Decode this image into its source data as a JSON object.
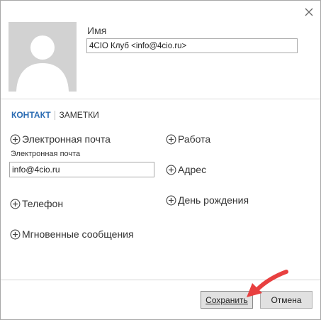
{
  "dialog": {
    "close_icon": "close-icon",
    "name_label": "Имя",
    "name_value": "4CIO Клуб <info@4cio.ru>"
  },
  "tabs": {
    "contact": "КОНТАКТ",
    "notes": "ЗАМЕТКИ"
  },
  "fields": {
    "email_add": "Электронная почта",
    "email_caption": "Электронная почта",
    "email_value": "info@4cio.ru",
    "phone_add": "Телефон",
    "im_add": "Мгновенные сообщения",
    "work_add": "Работа",
    "address_add": "Адрес",
    "birthday_add": "День рождения"
  },
  "buttons": {
    "save": "Сохранить",
    "cancel": "Отмена"
  },
  "colors": {
    "accent_tab": "#2b6cb3",
    "annotation_arrow": "#e84040",
    "avatar_bg": "#d2d2d2"
  }
}
